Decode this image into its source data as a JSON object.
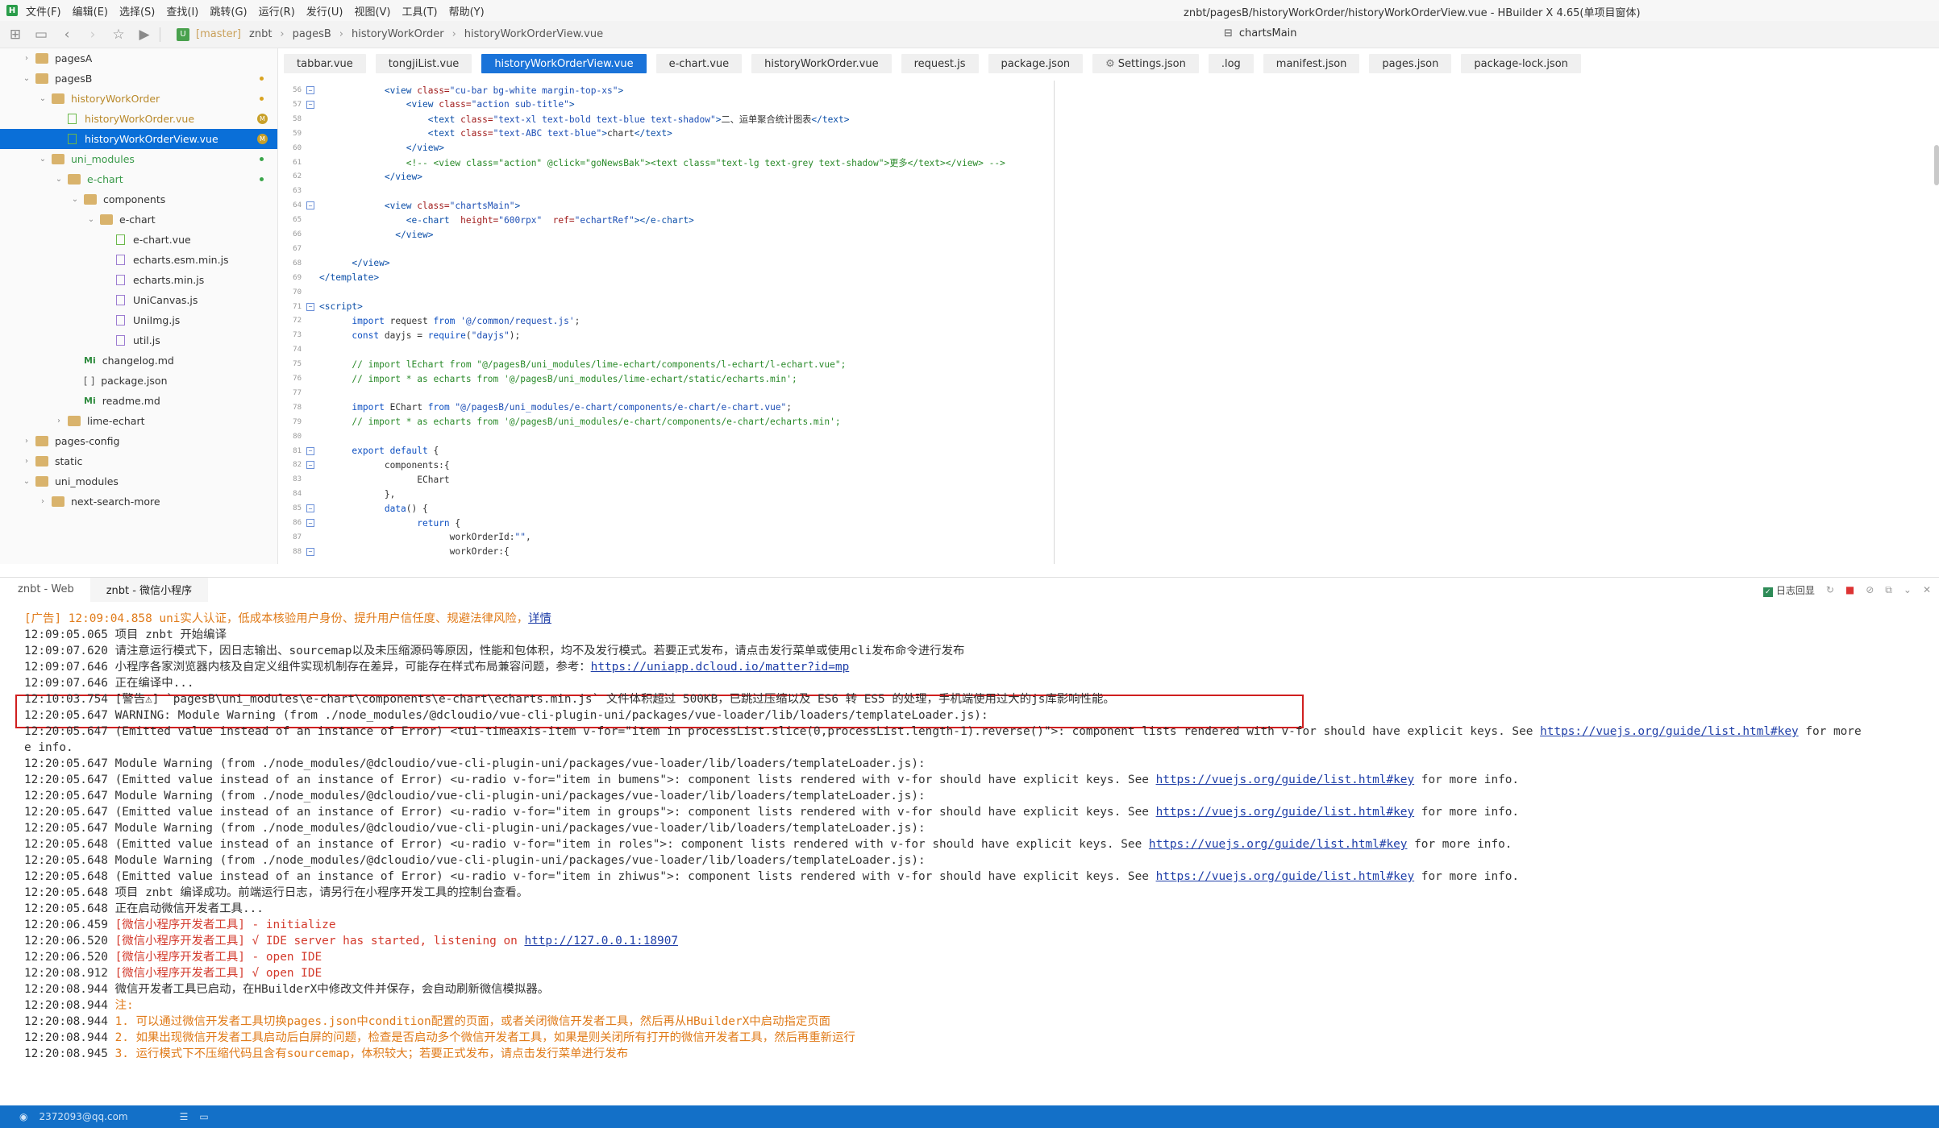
{
  "window": {
    "title": "znbt/pagesB/historyWorkOrder/historyWorkOrderView.vue - HBuilder X 4.65(单项目窗体)"
  },
  "menu": [
    "文件(F)",
    "编辑(E)",
    "选择(S)",
    "查找(I)",
    "跳转(G)",
    "运行(R)",
    "发行(U)",
    "视图(V)",
    "工具(T)",
    "帮助(Y)"
  ],
  "breadcrumb": {
    "branch": "[master]",
    "items": [
      "znbt",
      "pagesB",
      "historyWorkOrder",
      "historyWorkOrderView.vue"
    ],
    "symbol": "chartsMain"
  },
  "tree": [
    {
      "label": "pagesA",
      "indent": 0,
      "kind": "folder",
      "twisty": "›",
      "status": ""
    },
    {
      "label": "pagesB",
      "indent": 0,
      "kind": "folder",
      "twisty": "⌄",
      "status": "dot-orange"
    },
    {
      "label": "historyWorkOrder",
      "indent": 1,
      "kind": "folder",
      "twisty": "⌄",
      "status": "dot-orange",
      "color": "#b9892a"
    },
    {
      "label": "historyWorkOrder.vue",
      "indent": 2,
      "kind": "vue",
      "twisty": "",
      "status": "M",
      "color": "#b9892a"
    },
    {
      "label": "historyWorkOrderView.vue",
      "indent": 2,
      "kind": "vue",
      "twisty": "",
      "status": "M",
      "selected": true
    },
    {
      "label": "uni_modules",
      "indent": 1,
      "kind": "folder",
      "twisty": "⌄",
      "status": "dot-green",
      "color": "#3a9a4a"
    },
    {
      "label": "e-chart",
      "indent": 2,
      "kind": "folder",
      "twisty": "⌄",
      "status": "dot-green",
      "color": "#3a9a4a"
    },
    {
      "label": "components",
      "indent": 3,
      "kind": "folder",
      "twisty": "⌄",
      "status": ""
    },
    {
      "label": "e-chart",
      "indent": 4,
      "kind": "folder",
      "twisty": "⌄",
      "status": ""
    },
    {
      "label": "e-chart.vue",
      "indent": 5,
      "kind": "vue",
      "twisty": "",
      "status": ""
    },
    {
      "label": "echarts.esm.min.js",
      "indent": 5,
      "kind": "js",
      "twisty": "",
      "status": ""
    },
    {
      "label": "echarts.min.js",
      "indent": 5,
      "kind": "js",
      "twisty": "",
      "status": ""
    },
    {
      "label": "UniCanvas.js",
      "indent": 5,
      "kind": "js",
      "twisty": "",
      "status": ""
    },
    {
      "label": "UniImg.js",
      "indent": 5,
      "kind": "js",
      "twisty": "",
      "status": ""
    },
    {
      "label": "util.js",
      "indent": 5,
      "kind": "js",
      "twisty": "",
      "status": ""
    },
    {
      "label": "changelog.md",
      "indent": 3,
      "kind": "md",
      "twisty": "",
      "status": ""
    },
    {
      "label": "package.json",
      "indent": 3,
      "kind": "json",
      "twisty": "",
      "status": ""
    },
    {
      "label": "readme.md",
      "indent": 3,
      "kind": "md",
      "twisty": "",
      "status": ""
    },
    {
      "label": "lime-echart",
      "indent": 2,
      "kind": "folder",
      "twisty": "›",
      "status": ""
    },
    {
      "label": "pages-config",
      "indent": 0,
      "kind": "folder",
      "twisty": "›",
      "status": ""
    },
    {
      "label": "static",
      "indent": 0,
      "kind": "folder",
      "twisty": "›",
      "status": ""
    },
    {
      "label": "uni_modules",
      "indent": 0,
      "kind": "folder",
      "twisty": "⌄",
      "status": ""
    },
    {
      "label": "next-search-more",
      "indent": 1,
      "kind": "folder",
      "twisty": "›",
      "status": ""
    }
  ],
  "tabs": [
    {
      "label": "tabbar.vue"
    },
    {
      "label": "tongjiList.vue"
    },
    {
      "label": "historyWorkOrderView.vue",
      "active": true
    },
    {
      "label": "e-chart.vue"
    },
    {
      "label": "historyWorkOrder.vue"
    },
    {
      "label": "request.js"
    },
    {
      "label": "package.json"
    },
    {
      "label": "Settings.json",
      "gear": true
    },
    {
      "label": ".log"
    },
    {
      "label": "manifest.json"
    },
    {
      "label": "pages.json"
    },
    {
      "label": "package-lock.json"
    }
  ],
  "code": [
    {
      "n": "56",
      "fold": true,
      "indent": 6,
      "parts": [
        [
          "tag",
          "<view "
        ],
        [
          "attr",
          "class="
        ],
        [
          "str",
          "\"cu-bar bg-white margin-top-xs\""
        ],
        [
          "tag",
          ">"
        ]
      ]
    },
    {
      "n": "57",
      "fold": true,
      "indent": 8,
      "parts": [
        [
          "tag",
          "<view "
        ],
        [
          "attr",
          "class="
        ],
        [
          "str",
          "\"action sub-title\""
        ],
        [
          "tag",
          ">"
        ]
      ]
    },
    {
      "n": "58",
      "fold": false,
      "indent": 10,
      "parts": [
        [
          "tag",
          "<text "
        ],
        [
          "attr",
          "class="
        ],
        [
          "str",
          "\"text-xl text-bold text-blue text-shadow\""
        ],
        [
          "tag",
          ">"
        ],
        [
          "text",
          "二、运单聚合统计图表"
        ],
        [
          "tag",
          "</text>"
        ]
      ]
    },
    {
      "n": "59",
      "fold": false,
      "indent": 10,
      "parts": [
        [
          "tag",
          "<text "
        ],
        [
          "attr",
          "class="
        ],
        [
          "str",
          "\"text-ABC text-blue\""
        ],
        [
          "tag",
          ">"
        ],
        [
          "text",
          "chart"
        ],
        [
          "tag",
          "</text>"
        ]
      ]
    },
    {
      "n": "60",
      "fold": false,
      "indent": 8,
      "parts": [
        [
          "tag",
          "</view>"
        ]
      ]
    },
    {
      "n": "61",
      "fold": false,
      "indent": 8,
      "parts": [
        [
          "cmt",
          "<!-- <view class=\"action\" @click=\"goNewsBak\"><text class=\"text-lg text-grey text-shadow\">更多</text></view> -->"
        ]
      ]
    },
    {
      "n": "62",
      "fold": false,
      "indent": 6,
      "parts": [
        [
          "tag",
          "</view>"
        ]
      ]
    },
    {
      "n": "63",
      "fold": false,
      "indent": 0,
      "parts": []
    },
    {
      "n": "64",
      "fold": true,
      "indent": 6,
      "parts": [
        [
          "tag",
          "<view "
        ],
        [
          "attr",
          "class="
        ],
        [
          "str",
          "\"chartsMain\""
        ],
        [
          "tag",
          ">"
        ]
      ]
    },
    {
      "n": "65",
      "fold": false,
      "indent": 8,
      "parts": [
        [
          "tag",
          "<e-chart  "
        ],
        [
          "attr",
          "height="
        ],
        [
          "str",
          "\"600rpx\"  "
        ],
        [
          "attr",
          "ref="
        ],
        [
          "str",
          "\"echartRef\""
        ],
        [
          "tag",
          "></e-chart>"
        ]
      ]
    },
    {
      "n": "66",
      "fold": false,
      "indent": 7,
      "parts": [
        [
          "tag",
          "</view>"
        ]
      ]
    },
    {
      "n": "67",
      "fold": false,
      "indent": 0,
      "parts": []
    },
    {
      "n": "68",
      "fold": false,
      "indent": 3,
      "parts": [
        [
          "tag",
          "</view>"
        ]
      ]
    },
    {
      "n": "69",
      "fold": false,
      "indent": 0,
      "parts": [
        [
          "tag",
          "</template>"
        ]
      ]
    },
    {
      "n": "70",
      "fold": false,
      "indent": 0,
      "parts": []
    },
    {
      "n": "71",
      "fold": true,
      "indent": 0,
      "parts": [
        [
          "tag",
          "<script>"
        ]
      ]
    },
    {
      "n": "72",
      "fold": false,
      "indent": 3,
      "parts": [
        [
          "kw",
          "import "
        ],
        [
          "plain",
          "request "
        ],
        [
          "kw",
          "from "
        ],
        [
          "str",
          "'@/common/request.js'"
        ],
        [
          "plain",
          ";"
        ]
      ]
    },
    {
      "n": "73",
      "fold": false,
      "indent": 3,
      "parts": [
        [
          "kw",
          "const "
        ],
        [
          "plain",
          "dayjs = "
        ],
        [
          "kw",
          "require"
        ],
        [
          "plain",
          "("
        ],
        [
          "str",
          "\"dayjs\""
        ],
        [
          "plain",
          ");"
        ]
      ]
    },
    {
      "n": "74",
      "fold": false,
      "indent": 0,
      "parts": []
    },
    {
      "n": "75",
      "fold": false,
      "indent": 3,
      "parts": [
        [
          "cmt",
          "// import lEchart from \"@/pagesB/uni_modules/lime-echart/components/l-echart/l-echart.vue\";"
        ]
      ]
    },
    {
      "n": "76",
      "fold": false,
      "indent": 3,
      "parts": [
        [
          "cmt",
          "// import * as echarts from '@/pagesB/uni_modules/lime-echart/static/echarts.min';"
        ]
      ]
    },
    {
      "n": "77",
      "fold": false,
      "indent": 0,
      "parts": []
    },
    {
      "n": "78",
      "fold": false,
      "indent": 3,
      "parts": [
        [
          "kw",
          "import "
        ],
        [
          "plain",
          "EChart "
        ],
        [
          "kw",
          "from "
        ],
        [
          "str",
          "\"@/pagesB/uni_modules/e-chart/components/e-chart/e-chart.vue\""
        ],
        [
          "plain",
          ";"
        ]
      ]
    },
    {
      "n": "79",
      "fold": false,
      "indent": 3,
      "parts": [
        [
          "cmt",
          "// import * as echarts from '@/pagesB/uni_modules/e-chart/components/e-chart/echarts.min';"
        ]
      ]
    },
    {
      "n": "80",
      "fold": false,
      "indent": 0,
      "parts": []
    },
    {
      "n": "81",
      "fold": true,
      "indent": 3,
      "parts": [
        [
          "kw",
          "export default "
        ],
        [
          "plain",
          "{"
        ]
      ]
    },
    {
      "n": "82",
      "fold": true,
      "indent": 6,
      "parts": [
        [
          "plain",
          "components:{"
        ]
      ]
    },
    {
      "n": "83",
      "fold": false,
      "indent": 9,
      "parts": [
        [
          "plain",
          "EChart"
        ]
      ]
    },
    {
      "n": "84",
      "fold": false,
      "indent": 6,
      "parts": [
        [
          "plain",
          "},"
        ]
      ]
    },
    {
      "n": "85",
      "fold": true,
      "indent": 6,
      "parts": [
        [
          "kw",
          "data"
        ],
        [
          "plain",
          "() {"
        ]
      ]
    },
    {
      "n": "86",
      "fold": true,
      "indent": 9,
      "parts": [
        [
          "kw",
          "return "
        ],
        [
          "plain",
          "{"
        ]
      ]
    },
    {
      "n": "87",
      "fold": false,
      "indent": 12,
      "parts": [
        [
          "plain",
          "workOrderId:"
        ],
        [
          "str",
          "\"\""
        ],
        [
          "plain",
          ","
        ]
      ]
    },
    {
      "n": "88",
      "fold": true,
      "indent": 12,
      "parts": [
        [
          "plain",
          "workOrder:{"
        ]
      ]
    }
  ],
  "console": {
    "tabs": [
      {
        "label": "znbt - Web"
      },
      {
        "label": "znbt - 微信小程序",
        "active": true
      }
    ],
    "log_echo_label": "日志回显",
    "lines": [
      {
        "ts": "",
        "segments": [
          [
            "orange",
            "[广告] 12:09:04.858 uni实人认证，低成本核验用户身份、提升用户信任度、规避法律风险，"
          ],
          [
            "link",
            "详情"
          ]
        ]
      },
      {
        "ts": "12:09:05.065 ",
        "segments": [
          [
            "plain",
            "项目 znbt 开始编译"
          ]
        ]
      },
      {
        "ts": "12:09:07.620 ",
        "segments": [
          [
            "plain",
            "请注意运行模式下，因日志输出、sourcemap以及未压缩源码等原因，性能和包体积，均不及发行模式。若要正式发布，请点击发行菜单或使用cli发布命令进行发布"
          ]
        ]
      },
      {
        "ts": "12:09:07.646 ",
        "segments": [
          [
            "plain",
            "小程序各家浏览器内核及自定义组件实现机制存在差异，可能存在样式布局兼容问题，参考："
          ],
          [
            "link",
            "https://uniapp.dcloud.io/matter?id=mp"
          ]
        ]
      },
      {
        "ts": "12:09:07.646 ",
        "segments": [
          [
            "plain",
            "正在编译中..."
          ]
        ]
      },
      {
        "ts": "12:10:03.754 ",
        "segments": [
          [
            "plain",
            "[警告⚠] `pagesB\\uni_modules\\e-chart\\components\\e-chart\\echarts.min.js` 文件体积超过 500KB，已跳过压缩以及 ES6 转 ES5 的处理，手机端使用过大的js库影响性能。"
          ]
        ]
      },
      {
        "ts": "12:20:05.647 ",
        "segments": [
          [
            "plain",
            "WARNING: Module Warning (from ./node_modules/@dcloudio/vue-cli-plugin-uni/packages/vue-loader/lib/loaders/templateLoader.js):"
          ]
        ]
      },
      {
        "ts": "12:20:05.647 ",
        "segments": [
          [
            "plain",
            "(Emitted value instead of an instance of Error) <tui-timeaxis-item v-for=\"item in processList.slice(0,processList.length-1).reverse()\">: component lists rendered with v-for should have explicit keys. See "
          ],
          [
            "link",
            "https://vuejs.org/guide/list.html#key"
          ],
          [
            "plain",
            " for more"
          ]
        ]
      },
      {
        "ts": "",
        "segments": [
          [
            "plain",
            "e info."
          ]
        ],
        "noindent": true
      },
      {
        "ts": "12:20:05.647 ",
        "segments": [
          [
            "plain",
            "Module Warning (from ./node_modules/@dcloudio/vue-cli-plugin-uni/packages/vue-loader/lib/loaders/templateLoader.js):"
          ]
        ]
      },
      {
        "ts": "12:20:05.647 ",
        "segments": [
          [
            "plain",
            "(Emitted value instead of an instance of Error) <u-radio v-for=\"item in bumens\">: component lists rendered with v-for should have explicit keys. See "
          ],
          [
            "link",
            "https://vuejs.org/guide/list.html#key"
          ],
          [
            "plain",
            " for more info."
          ]
        ]
      },
      {
        "ts": "12:20:05.647 ",
        "segments": [
          [
            "plain",
            "Module Warning (from ./node_modules/@dcloudio/vue-cli-plugin-uni/packages/vue-loader/lib/loaders/templateLoader.js):"
          ]
        ]
      },
      {
        "ts": "12:20:05.647 ",
        "segments": [
          [
            "plain",
            "(Emitted value instead of an instance of Error) <u-radio v-for=\"item in groups\">: component lists rendered with v-for should have explicit keys. See "
          ],
          [
            "link",
            "https://vuejs.org/guide/list.html#key"
          ],
          [
            "plain",
            " for more info."
          ]
        ]
      },
      {
        "ts": "12:20:05.647 ",
        "segments": [
          [
            "plain",
            "Module Warning (from ./node_modules/@dcloudio/vue-cli-plugin-uni/packages/vue-loader/lib/loaders/templateLoader.js):"
          ]
        ]
      },
      {
        "ts": "12:20:05.648 ",
        "segments": [
          [
            "plain",
            "(Emitted value instead of an instance of Error) <u-radio v-for=\"item in roles\">: component lists rendered with v-for should have explicit keys. See "
          ],
          [
            "link",
            "https://vuejs.org/guide/list.html#key"
          ],
          [
            "plain",
            " for more info."
          ]
        ]
      },
      {
        "ts": "12:20:05.648 ",
        "segments": [
          [
            "plain",
            "Module Warning (from ./node_modules/@dcloudio/vue-cli-plugin-uni/packages/vue-loader/lib/loaders/templateLoader.js):"
          ]
        ]
      },
      {
        "ts": "12:20:05.648 ",
        "segments": [
          [
            "plain",
            "(Emitted value instead of an instance of Error) <u-radio v-for=\"item in zhiwus\">: component lists rendered with v-for should have explicit keys. See "
          ],
          [
            "link",
            "https://vuejs.org/guide/list.html#key"
          ],
          [
            "plain",
            " for more info."
          ]
        ]
      },
      {
        "ts": "12:20:05.648 ",
        "segments": [
          [
            "plain",
            "项目 znbt 编译成功。前端运行日志，请另行在小程序开发工具的控制台查看。"
          ]
        ]
      },
      {
        "ts": "12:20:05.648 ",
        "segments": [
          [
            "plain",
            "正在启动微信开发者工具..."
          ]
        ]
      },
      {
        "ts": "12:20:06.459 ",
        "segments": [
          [
            "red",
            "[微信小程序开发者工具] - initialize"
          ]
        ]
      },
      {
        "ts": "12:20:06.520 ",
        "segments": [
          [
            "red",
            "[微信小程序开发者工具] √ IDE server has started, listening on "
          ],
          [
            "link",
            "http://127.0.0.1:18907"
          ]
        ]
      },
      {
        "ts": "12:20:06.520 ",
        "segments": [
          [
            "red",
            "[微信小程序开发者工具] - open IDE"
          ]
        ]
      },
      {
        "ts": "12:20:08.912 ",
        "segments": [
          [
            "red",
            "[微信小程序开发者工具] √ open IDE"
          ]
        ]
      },
      {
        "ts": "12:20:08.944 ",
        "segments": [
          [
            "plain",
            "微信开发者工具已启动，在HBuilderX中修改文件并保存，会自动刷新微信模拟器。"
          ]
        ]
      },
      {
        "ts": "12:20:08.944 ",
        "segments": [
          [
            "orange",
            "注:"
          ]
        ]
      },
      {
        "ts": "12:20:08.944 ",
        "segments": [
          [
            "orange",
            "1. 可以通过微信开发者工具切换pages.json中condition配置的页面，或者关闭微信开发者工具，然后再从HBuilderX中启动指定页面"
          ]
        ]
      },
      {
        "ts": "12:20:08.944 ",
        "segments": [
          [
            "orange",
            "2. 如果出现微信开发者工具启动后白屏的问题，检查是否启动多个微信开发者工具，如果是则关闭所有打开的微信开发者工具，然后再重新运行"
          ]
        ]
      },
      {
        "ts": "12:20:08.945 ",
        "segments": [
          [
            "orange",
            "3. 运行模式下不压缩代码且含有sourcemap，体积较大；若要正式发布，请点击发行菜单进行发布"
          ]
        ]
      }
    ]
  },
  "status": {
    "user": "2372093@qq.com"
  },
  "colors": {
    "accent": "#1a73d9",
    "statusbar": "#1370c8",
    "warning_box": "#d01f1f",
    "orange": "#e07b1a",
    "red": "#d33a2c"
  }
}
